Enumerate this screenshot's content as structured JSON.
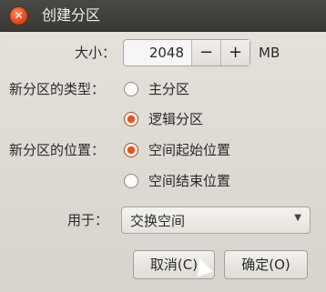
{
  "window": {
    "title": "创建分区"
  },
  "size": {
    "label": "大小：",
    "value": "2048",
    "minus": "−",
    "plus": "+",
    "unit": "MB"
  },
  "partition_type": {
    "label": "新分区的类型：",
    "options": [
      {
        "label": "主分区",
        "checked": false
      },
      {
        "label": "逻辑分区",
        "checked": true
      }
    ]
  },
  "partition_location": {
    "label": "新分区的位置：",
    "options": [
      {
        "label": "空间起始位置",
        "checked": true
      },
      {
        "label": "空间结束位置",
        "checked": false
      }
    ]
  },
  "use_as": {
    "label": "用于：",
    "selected": "交换空间"
  },
  "buttons": {
    "cancel": "取消(C)",
    "ok": "确定(O)"
  },
  "icons": {
    "close": "close-icon",
    "dropdown": "chevron-down-icon",
    "cursor": "mouse-pointer-icon"
  }
}
